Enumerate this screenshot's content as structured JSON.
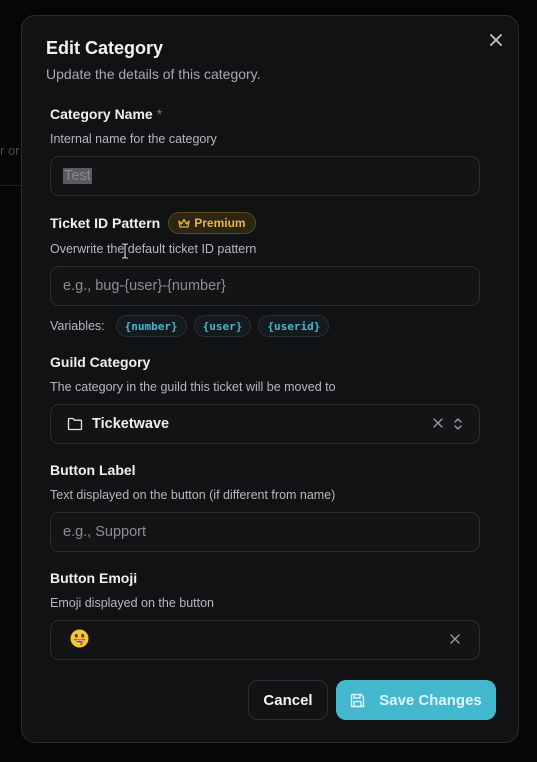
{
  "background": {
    "text": "r or"
  },
  "dialog": {
    "title": "Edit Category",
    "subtitle": "Update the details of this category.",
    "close_icon": "close-icon"
  },
  "fields": {
    "category_name": {
      "label": "Category Name",
      "required_mark": "*",
      "help": "Internal name for the category",
      "value": "Test"
    },
    "ticket_id_pattern": {
      "label": "Ticket ID Pattern",
      "badge": "Premium",
      "badge_icon": "crown-icon",
      "help": "Overwrite the default ticket ID pattern",
      "placeholder": "e.g., bug-{user}-{number}",
      "variables_label": "Variables:",
      "variables": [
        "{number}",
        "{user}",
        "{userid}"
      ]
    },
    "guild_category": {
      "label": "Guild Category",
      "help": "The category in the guild this ticket will be moved to",
      "selected": "Ticketwave",
      "icon": "folder-icon"
    },
    "button_label": {
      "label": "Button Label",
      "help": "Text displayed on the button (if different from name)",
      "placeholder": "e.g., Support"
    },
    "button_emoji": {
      "label": "Button Emoji",
      "help": "Emoji displayed on the button",
      "value_icon": "grinning-tongue-emoji"
    }
  },
  "actions": {
    "cancel": "Cancel",
    "save": "Save Changes",
    "save_icon": "save-icon"
  },
  "colors": {
    "accent": "#44b8cf",
    "premium": "#e7b53a",
    "required": "#d9534f",
    "surface": "#111214"
  }
}
